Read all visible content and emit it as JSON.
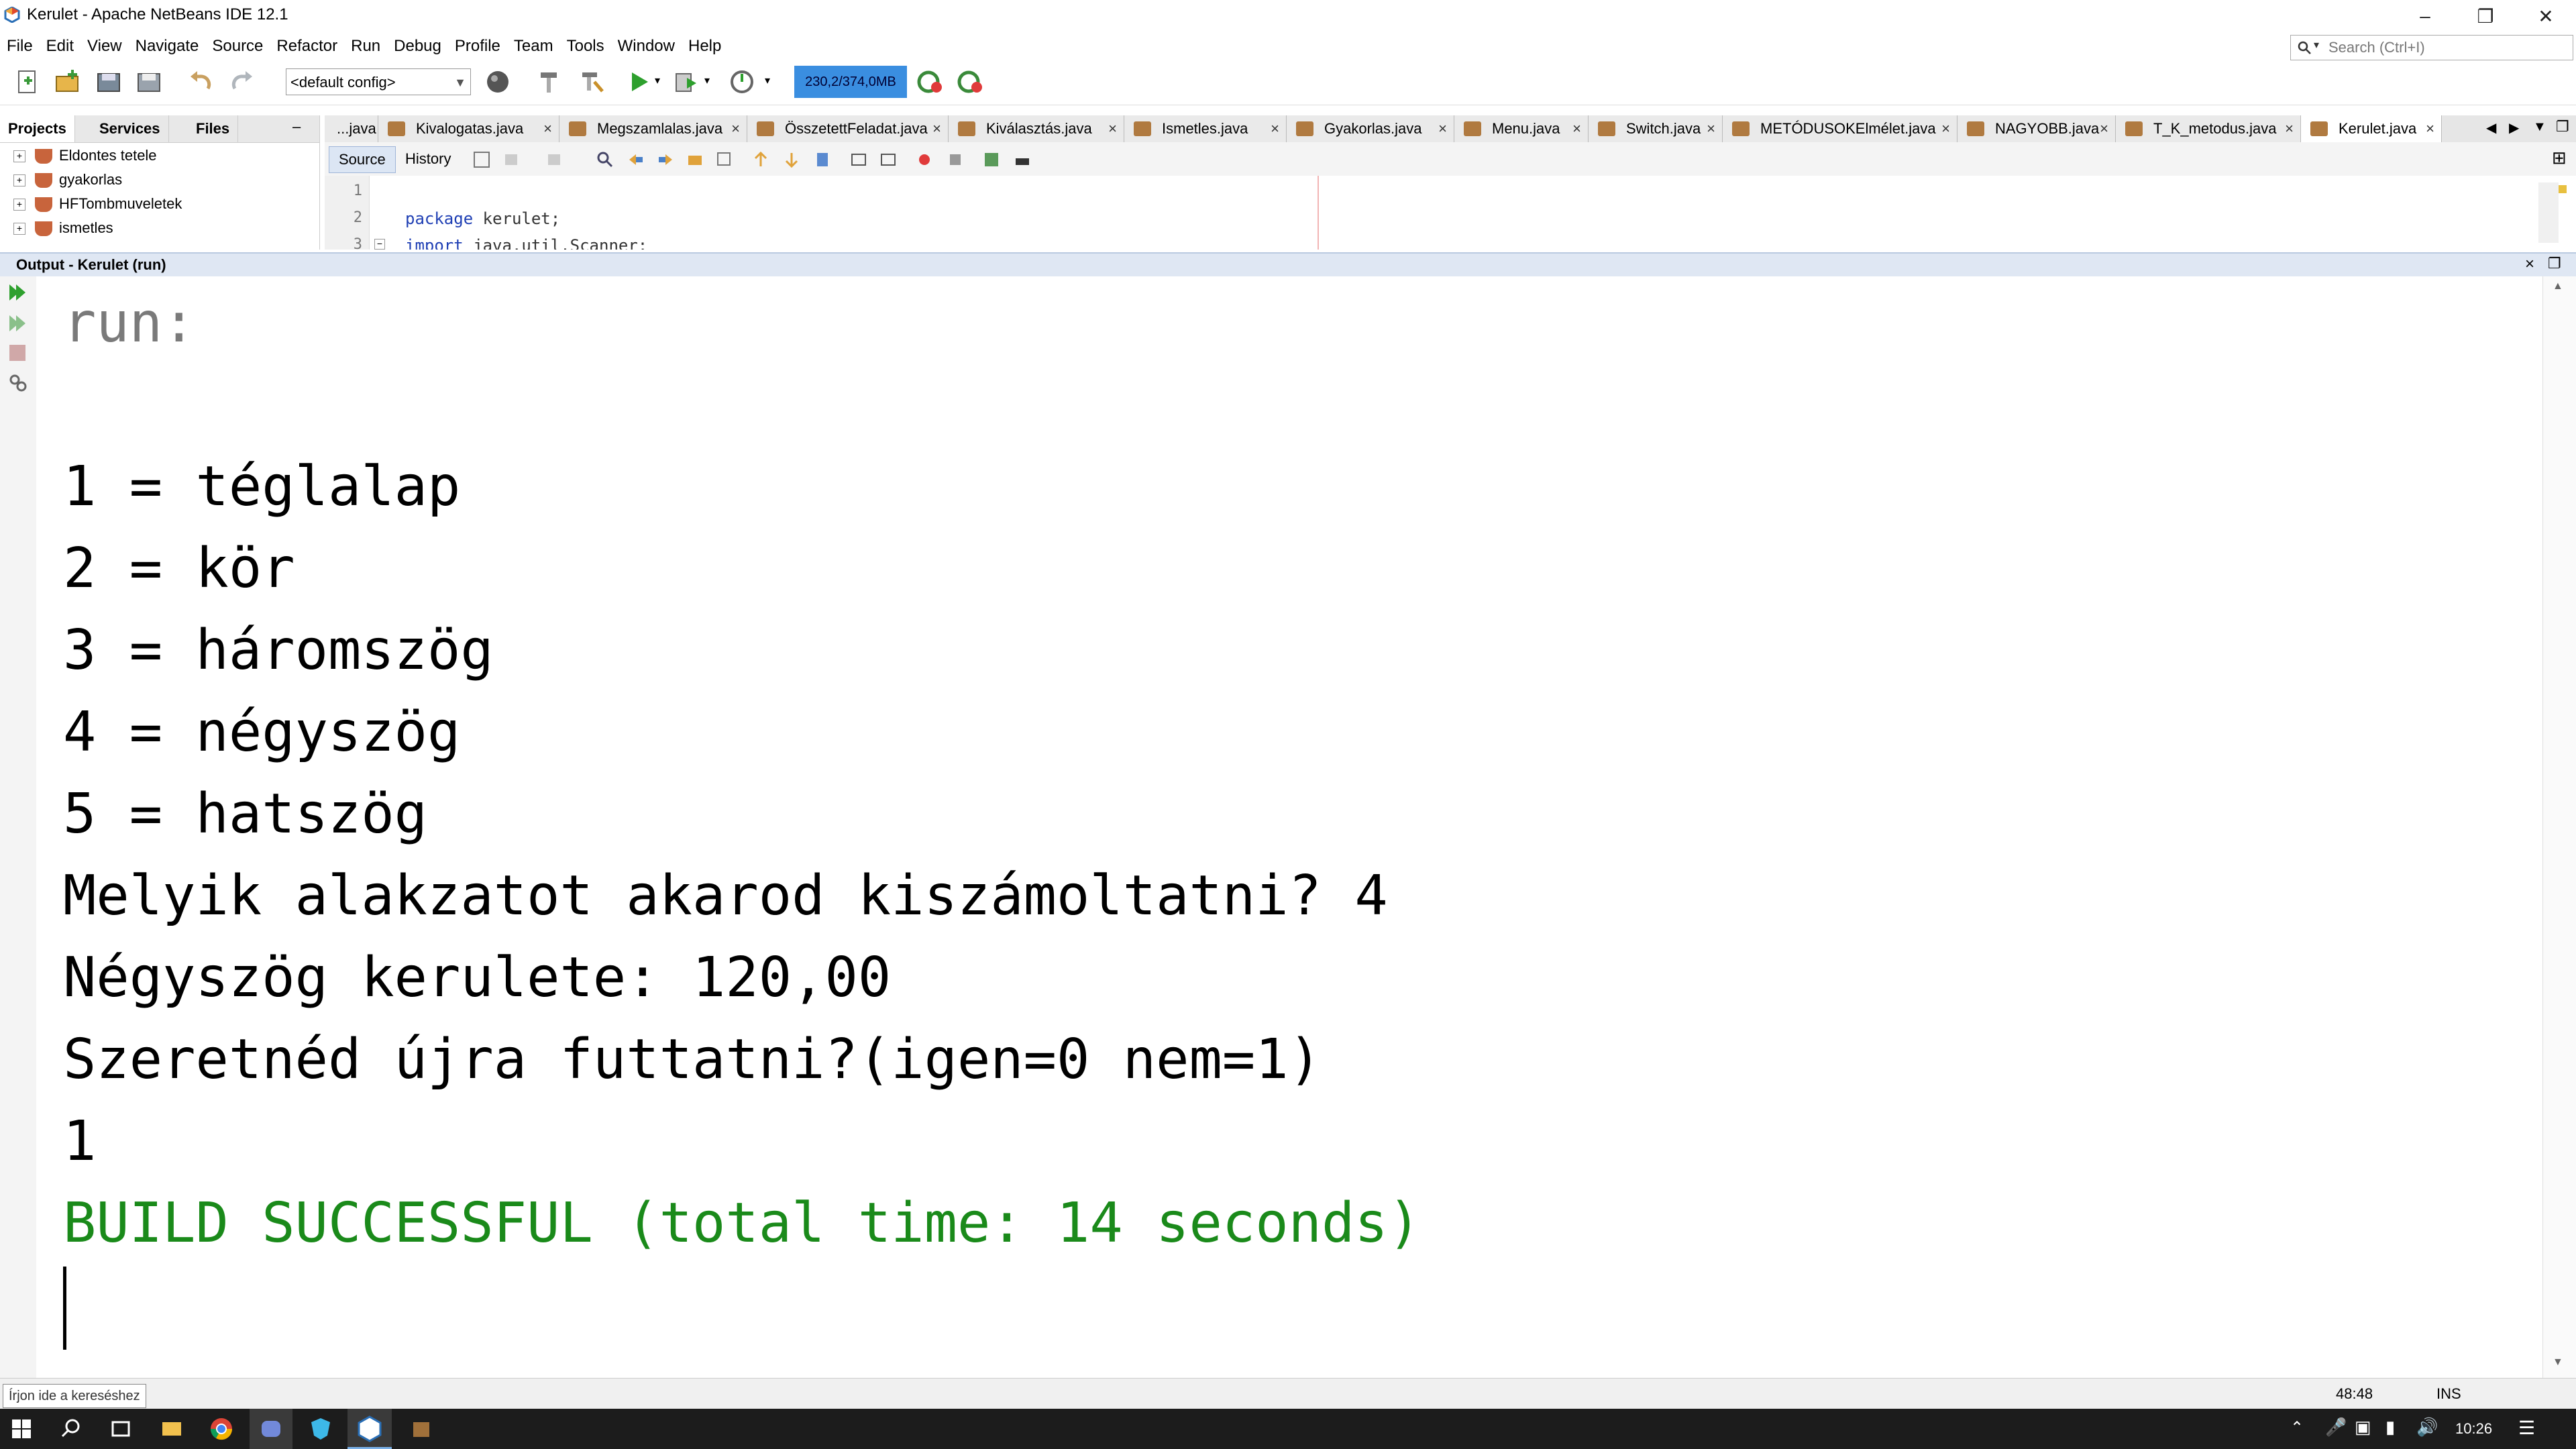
{
  "window": {
    "title": "Kerulet - Apache NetBeans IDE 12.1",
    "controls": [
      "minimize-icon",
      "restore-icon",
      "close-icon"
    ]
  },
  "menu": {
    "items": [
      "File",
      "Edit",
      "View",
      "Navigate",
      "Source",
      "Refactor",
      "Run",
      "Debug",
      "Profile",
      "Team",
      "Tools",
      "Window",
      "Help"
    ],
    "search_placeholder": "Search (Ctrl+I)"
  },
  "toolbar": {
    "config_value": "<default config>",
    "memory": "230,2/374,0MB"
  },
  "projects": {
    "tabs": [
      "Projects",
      "Services",
      "Files"
    ],
    "items": [
      "Eldontes tetele",
      "gyakorlas",
      "HFTombmuveletek",
      "ismetles"
    ]
  },
  "editor": {
    "tabs": [
      "...java",
      "Kivalogatas.java",
      "Megszamlalas.java",
      "ÖsszetettFeladat.java",
      "Kiválasztás.java",
      "Ismetles.java",
      "Gyakorlas.java",
      "Menu.java",
      "Switch.java",
      "METÓDUSOKElmélet.java",
      "NAGYOBB.java",
      "T_K_metodus.java",
      "Kerulet.java"
    ],
    "active_tab": "Kerulet.java",
    "view_buttons": [
      "Source",
      "History"
    ],
    "line_numbers": [
      "1",
      "2",
      "3"
    ],
    "code_lines": [
      {
        "kw": "",
        "text": ""
      },
      {
        "kw": "package",
        "text": " kerulet;"
      },
      {
        "kw": "import",
        "text": " java.util.Scanner;"
      }
    ]
  },
  "output": {
    "title": "Output - Kerulet (run)",
    "lines": [
      {
        "text": "run:",
        "color": "#7a7a7a"
      },
      {
        "text": "",
        "color": "#000000"
      },
      {
        "text": "1 = téglalap",
        "color": "#000000"
      },
      {
        "text": "2 = kör",
        "color": "#000000"
      },
      {
        "text": "3 = háromszög",
        "color": "#000000"
      },
      {
        "text": "4 = négyszög",
        "color": "#000000"
      },
      {
        "text": "5 = hatszög",
        "color": "#000000"
      },
      {
        "text": "Melyik alakzatot akarod kiszámoltatni? 4",
        "color": "#000000"
      },
      {
        "text": "Négyszög kerulete: 120,00",
        "color": "#000000"
      },
      {
        "text": "Szeretnéd újra futtatni?(igen=0 nem=1)",
        "color": "#000000"
      },
      {
        "text": "1",
        "color": "#000000"
      },
      {
        "text": "BUILD SUCCESSFUL (total time: 14 seconds)",
        "color": "#1a8a1a"
      }
    ]
  },
  "statusbar": {
    "search": "Írjon ide a kereséshez",
    "position": "48:48",
    "mode": "INS"
  },
  "taskbar": {
    "time": "10:26",
    "apps": [
      "windows-start-icon",
      "search-icon",
      "task-view-icon",
      "file-explorer-icon",
      "chrome-icon",
      "discord-icon",
      "vpn-shield-icon",
      "netbeans-icon",
      "package-icon"
    ]
  }
}
